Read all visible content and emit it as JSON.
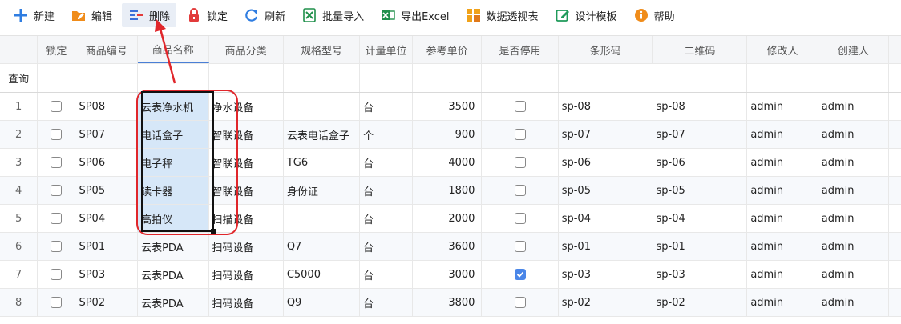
{
  "toolbar": {
    "items": [
      {
        "label": "新建",
        "icon": "plus-icon",
        "color": "#2f7de1"
      },
      {
        "label": "编辑",
        "icon": "folder-edit-icon",
        "color": "#f08c1a"
      },
      {
        "label": "删除",
        "icon": "delete-list-icon",
        "color": "#3a6fd8"
      },
      {
        "label": "锁定",
        "icon": "lock-icon",
        "color": "#e23b3b"
      },
      {
        "label": "刷新",
        "icon": "refresh-icon",
        "color": "#2f7de1"
      },
      {
        "label": "批量导入",
        "icon": "excel-import-icon",
        "color": "#1f8f4a"
      },
      {
        "label": "导出Excel",
        "icon": "excel-export-icon",
        "color": "#1f8f4a"
      },
      {
        "label": "数据透视表",
        "icon": "pivot-table-icon",
        "color": "#f0a21a"
      },
      {
        "label": "设计模板",
        "icon": "design-template-icon",
        "color": "#1f9a5a"
      },
      {
        "label": "帮助",
        "icon": "help-icon",
        "color": "#f08c1a"
      }
    ]
  },
  "grid": {
    "headers": {
      "lock": "锁定",
      "code": "商品编号",
      "name": "商品名称",
      "cat": "商品分类",
      "spec": "规格型号",
      "unit": "计量单位",
      "price": "参考单价",
      "dis": "是否停用",
      "bar": "条形码",
      "qr": "二维码",
      "mod": "修改人",
      "creator": "创建人"
    },
    "query_label": "查询",
    "rows": [
      {
        "idx": "1",
        "code": "SP08",
        "name": "云表净水机",
        "cat": "净水设备",
        "spec": "",
        "unit": "台",
        "price": "3500",
        "dis": false,
        "bar": "sp-08",
        "qr": "sp-08",
        "mod": "admin",
        "creator": "admin"
      },
      {
        "idx": "2",
        "code": "SP07",
        "name": "电话盒子",
        "cat": "智联设备",
        "spec": "云表电话盒子",
        "unit": "个",
        "price": "900",
        "dis": false,
        "bar": "sp-07",
        "qr": "sp-07",
        "mod": "admin",
        "creator": "admin"
      },
      {
        "idx": "3",
        "code": "SP06",
        "name": "电子秤",
        "cat": "智联设备",
        "spec": "TG6",
        "unit": "台",
        "price": "4000",
        "dis": false,
        "bar": "sp-06",
        "qr": "sp-06",
        "mod": "admin",
        "creator": "admin"
      },
      {
        "idx": "4",
        "code": "SP05",
        "name": "读卡器",
        "cat": "智联设备",
        "spec": "身份证",
        "unit": "台",
        "price": "1800",
        "dis": false,
        "bar": "sp-05",
        "qr": "sp-05",
        "mod": "admin",
        "creator": "admin"
      },
      {
        "idx": "5",
        "code": "SP04",
        "name": "高拍仪",
        "cat": "扫描设备",
        "spec": "",
        "unit": "台",
        "price": "2000",
        "dis": false,
        "bar": "sp-04",
        "qr": "sp-04",
        "mod": "admin",
        "creator": "admin"
      },
      {
        "idx": "6",
        "code": "SP01",
        "name": "云表PDA",
        "cat": "扫码设备",
        "spec": "Q7",
        "unit": "台",
        "price": "3600",
        "dis": false,
        "bar": "sp-01",
        "qr": "sp-01",
        "mod": "admin",
        "creator": "admin"
      },
      {
        "idx": "7",
        "code": "SP03",
        "name": "云表PDA",
        "cat": "扫码设备",
        "spec": "C5000",
        "unit": "台",
        "price": "3000",
        "dis": true,
        "bar": "sp-03",
        "qr": "sp-03",
        "mod": "admin",
        "creator": "admin"
      },
      {
        "idx": "8",
        "code": "SP02",
        "name": "云表PDA",
        "cat": "扫码设备",
        "spec": "Q9",
        "unit": "台",
        "price": "3800",
        "dis": false,
        "bar": "sp-02",
        "qr": "sp-02",
        "mod": "admin",
        "creator": "admin"
      }
    ],
    "selected_rows": [
      "1",
      "2",
      "3",
      "4",
      "5"
    ]
  },
  "colors": {
    "accent": "#4a7fd6",
    "selection_fill": "#d6e7f8",
    "annotation_red": "#e0262b",
    "checkbox_checked": "#4a86e8"
  }
}
